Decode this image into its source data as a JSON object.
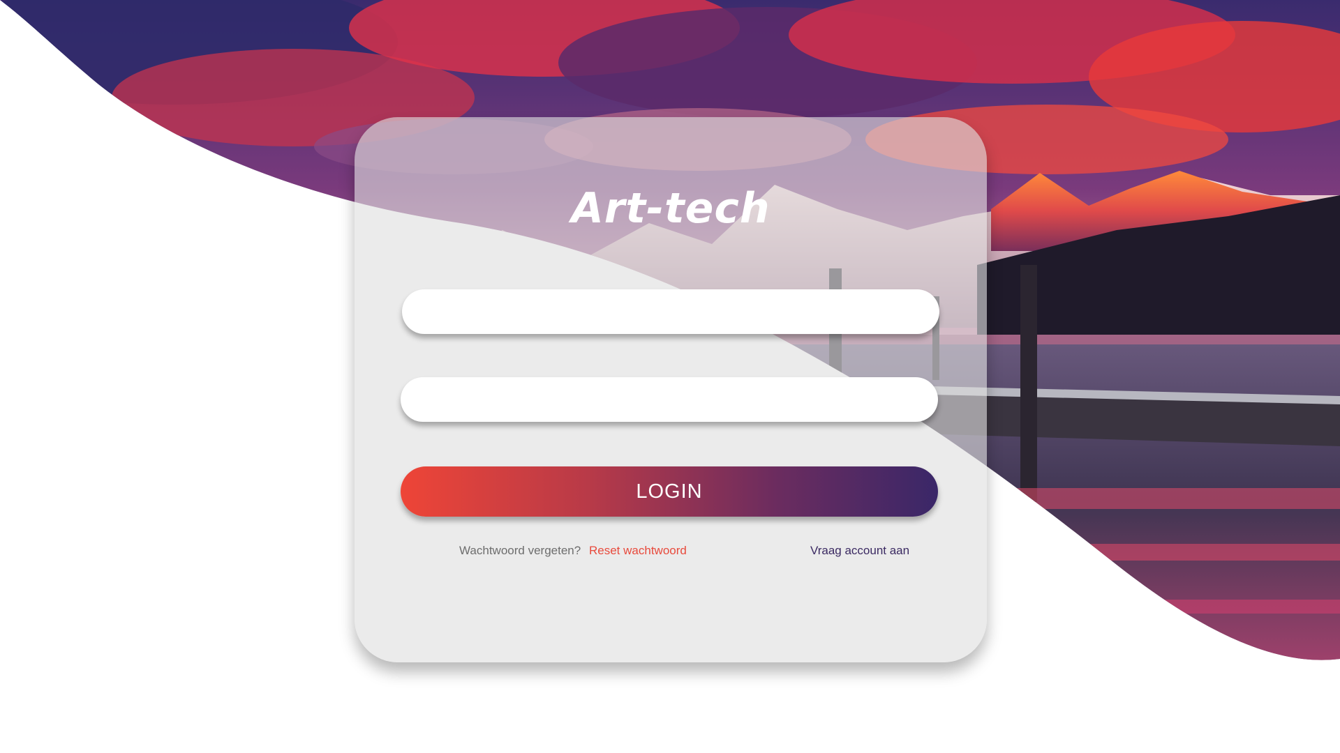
{
  "app": {
    "title": "Art-tech"
  },
  "form": {
    "username_value": "",
    "password_value": "",
    "login_label": "LOGIN"
  },
  "links": {
    "forgot_text": "Wachtwoord vergeten?",
    "reset_label": "Reset wachtwoord",
    "request_label": "Vraag account aan"
  },
  "colors": {
    "accent_start": "#ee4537",
    "accent_end": "#3a2768",
    "link_reset": "#e84a3c",
    "link_request": "#3b2a62"
  }
}
